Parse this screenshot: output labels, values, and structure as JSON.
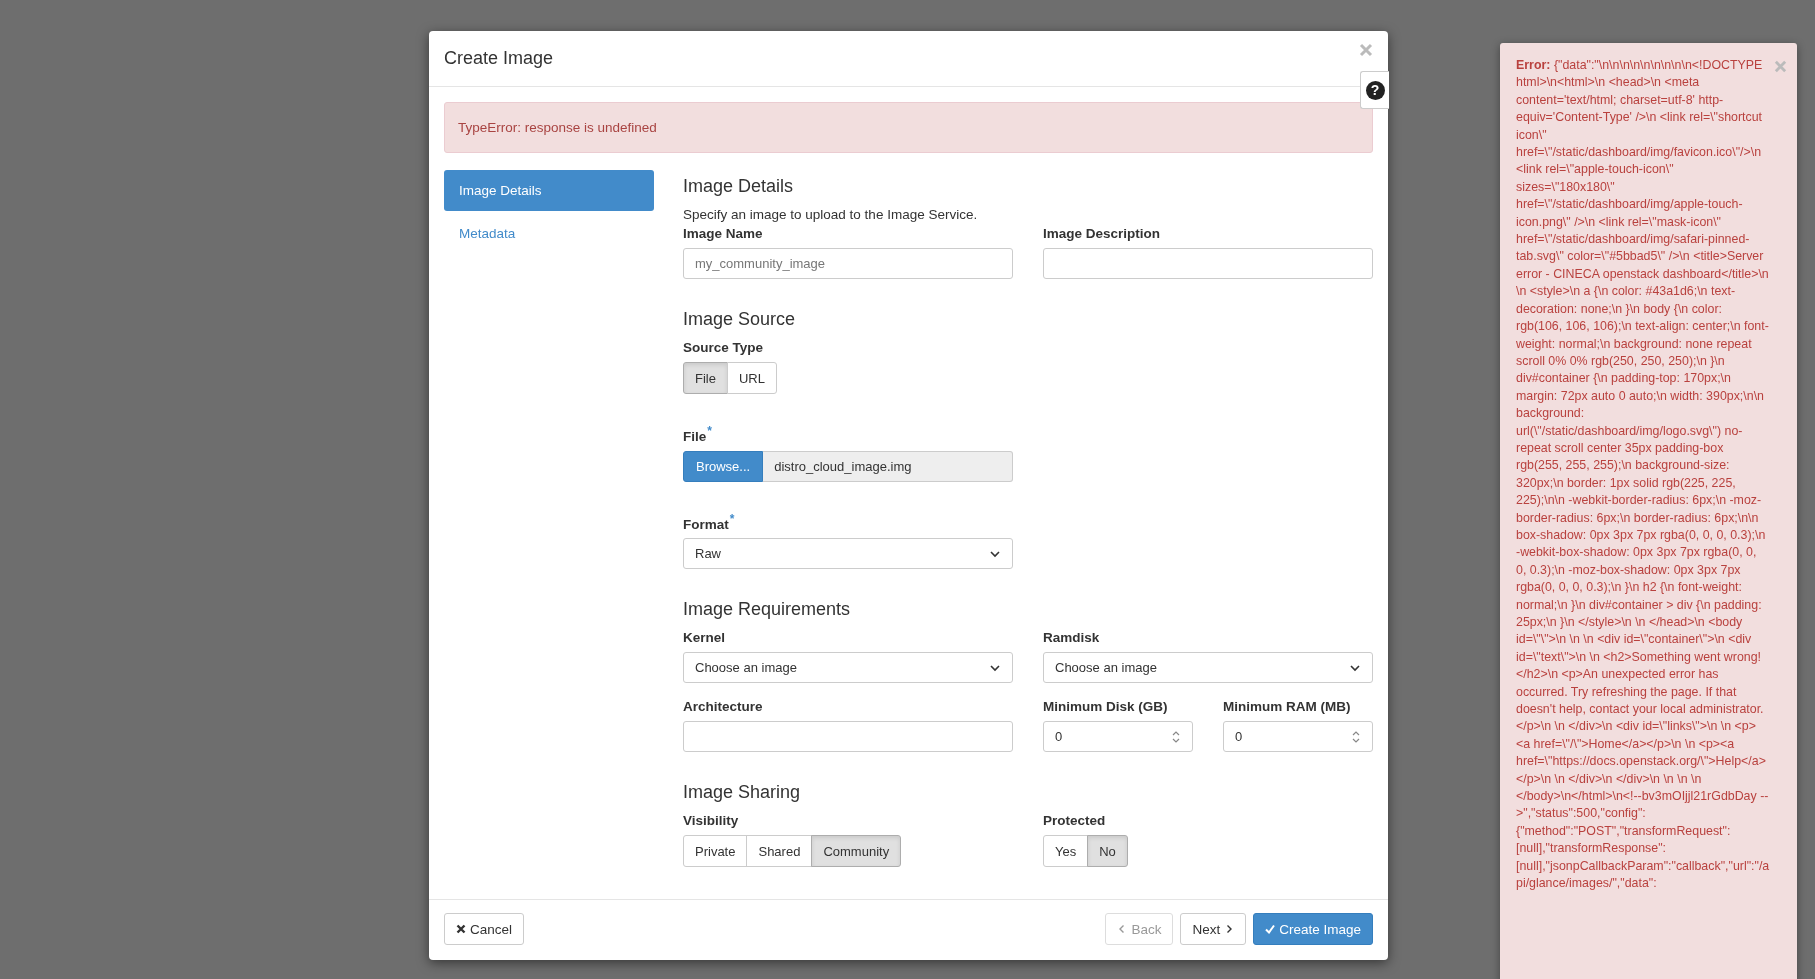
{
  "modal": {
    "title": "Create Image",
    "help": "?"
  },
  "alert": "TypeError: response is undefined",
  "steps": [
    {
      "label": "Image Details",
      "selected": true
    },
    {
      "label": "Metadata",
      "selected": false
    }
  ],
  "details": {
    "heading": "Image Details",
    "description": "Specify an image to upload to the Image Service.",
    "name": {
      "label": "Image Name",
      "placeholder": "my_community_image"
    },
    "description_field": {
      "label": "Image Description"
    }
  },
  "source": {
    "heading": "Image Source",
    "source_type": {
      "label": "Source Type",
      "options": [
        {
          "label": "File",
          "selected": true
        },
        {
          "label": "URL",
          "selected": false
        }
      ]
    },
    "file": {
      "label": "File",
      "required_mark": "*",
      "button": "Browse...",
      "value": "distro_cloud_image.img"
    },
    "format": {
      "label": "Format",
      "required_mark": "*",
      "value": "Raw"
    }
  },
  "requirements": {
    "heading": "Image Requirements",
    "kernel": {
      "label": "Kernel",
      "value": "Choose an image"
    },
    "ramdisk": {
      "label": "Ramdisk",
      "value": "Choose an image"
    },
    "architecture": {
      "label": "Architecture"
    },
    "min_disk": {
      "label": "Minimum Disk (GB)",
      "value": "0"
    },
    "min_ram": {
      "label": "Minimum RAM (MB)",
      "value": "0"
    }
  },
  "sharing": {
    "heading": "Image Sharing",
    "visibility": {
      "label": "Visibility",
      "options": [
        {
          "label": "Private",
          "selected": false
        },
        {
          "label": "Shared",
          "selected": false
        },
        {
          "label": "Community",
          "selected": true
        }
      ]
    },
    "protected": {
      "label": "Protected",
      "options": [
        {
          "label": "Yes",
          "selected": false
        },
        {
          "label": "No",
          "selected": true
        }
      ]
    }
  },
  "footer": {
    "cancel": "Cancel",
    "back": {
      "label": "Back",
      "disabled": true
    },
    "next": {
      "label": "Next",
      "disabled": false
    },
    "create": "Create Image"
  },
  "error_panel": {
    "text": "**Error:** {\"data\":\"\\n\\n\\n\\n\\n\\n\\n\\n\\n<!DOCTYPE html>\\n<html>\\n <head>\\n <meta content='text/html; charset=utf-8' http-equiv='Content-Type' />\\n <link rel=\\\"shortcut icon\\\" href=\\\"/static/dashboard/img/favicon.ico\\\"/>\\n <link rel=\\\"apple-touch-icon\\\" sizes=\\\"180x180\\\" href=\\\"/static/dashboard/img/apple-touch-icon.png\\\" />\\n <link rel=\\\"mask-icon\\\" href=\\\"/static/dashboard/img/safari-pinned-tab.svg\\\" color=\\\"#5bbad5\\\" />\\n <title>Server error - CINECA openstack dashboard</title>\\n \\n <style>\\n a {\\n color: #43a1d6;\\n text-decoration: none;\\n }\\n body {\\n color: rgb(106, 106, 106);\\n text-align: center;\\n font-weight: normal;\\n background: none repeat scroll 0% 0% rgb(250, 250, 250);\\n }\\n div#container {\\n padding-top: 170px;\\n margin: 72px auto 0 auto;\\n width: 390px;\\n\\n background: url(\\\"/static/dashboard/img/logo.svg\\\") no-repeat scroll center 35px padding-box rgb(255, 255, 255);\\n background-size: 320px;\\n border: 1px solid rgb(225, 225, 225);\\n\\n -webkit-border-radius: 6px;\\n -moz-border-radius: 6px;\\n border-radius: 6px;\\n\\n box-shadow: 0px 3px 7px rgba(0, 0, 0, 0.3);\\n -webkit-box-shadow: 0px 3px 7px rgba(0, 0, 0, 0.3);\\n -moz-box-shadow: 0px 3px 7px rgba(0, 0, 0, 0.3);\\n }\\n h2 {\\n font-weight: normal;\\n }\\n div#container > div {\\n padding: 25px;\\n }\\n </style>\\n \\n </head>\\n <body id=\\\"\\\">\\n \\n \\n <div id=\\\"container\\\">\\n <div id=\\\"text\\\">\\n \\n <h2>Something went wrong!</h2>\\n <p>An unexpected error has occurred. Try refreshing the page. If that doesn't help, contact your local administrator.</p>\\n \\n </div>\\n <div id=\\\"links\\\">\\n \\n <p><a href=\\\"/\\\">Home</a></p>\\n \\n <p><a href=\\\"https://docs.openstack.org/\\\">Help</a></p>\\n \\n </div>\\n </div>\\n \\n \\n \\n </body>\\n</html>\\n<!--bv3mOIjjl21rGdbDay -->\",\"status\":500,\"config\":{\"method\":\"POST\",\"transformRequest\":[null],\"transformResponse\":[null],\"jsonpCallbackParam\":\"callback\",\"url\":\"/api/glance/images/\",\"data\":"
  }
}
